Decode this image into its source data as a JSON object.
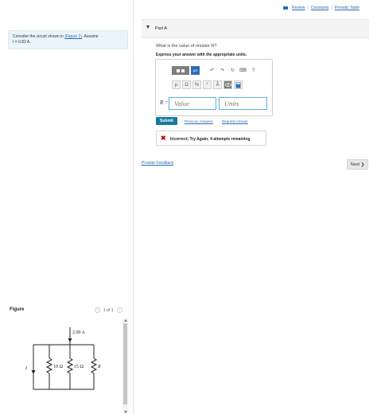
{
  "topbar": {
    "review": "Review",
    "sep": "|",
    "constants": "Constants",
    "periodic_table": "Periodic Table"
  },
  "problem": {
    "text_1": "Consider the circuit shown in ",
    "figure_link": "(Figure 1)",
    "text_2": ". Assume",
    "line_2": "I = 0.82 A."
  },
  "part": {
    "title": "Part A",
    "question": "What is the value of resistor R?",
    "instruction": "Express your answer with the appropriate units."
  },
  "toolbar": {
    "mu_label": "μA",
    "undo_icon": "↶",
    "redo_icon": "↷",
    "reset_icon": "↻",
    "keyboard_icon": "⌨",
    "help_icon": "?",
    "row2": [
      "μ",
      "Ω",
      "%",
      "°",
      "Å",
      "",
      ""
    ]
  },
  "answer": {
    "variable_label": "R =",
    "value_placeholder": "Value",
    "units_placeholder": "Units"
  },
  "actions": {
    "submit": "Submit",
    "previous_answers": "Previous Answers",
    "request_answer": "Request Answer"
  },
  "feedback": {
    "icon": "✖",
    "message": "Incorrect; Try Again; 4 attempts remaining"
  },
  "footer": {
    "provide_feedback": "Provide Feedback",
    "next": "Next ❯"
  },
  "figure": {
    "label": "Figure",
    "prev": "‹",
    "count": "1 of 1",
    "next": "›",
    "current_label": "2.00 A",
    "resistor_1": "10 Ω",
    "resistor_2": "15 Ω",
    "resistor_3": "R",
    "current_var": "I"
  },
  "colors": {
    "link": "#2d6db5",
    "submit_bg": "#167b9a",
    "error": "#d0021b",
    "input_border": "#5cb2de",
    "problem_bg": "#e9f5fb"
  }
}
